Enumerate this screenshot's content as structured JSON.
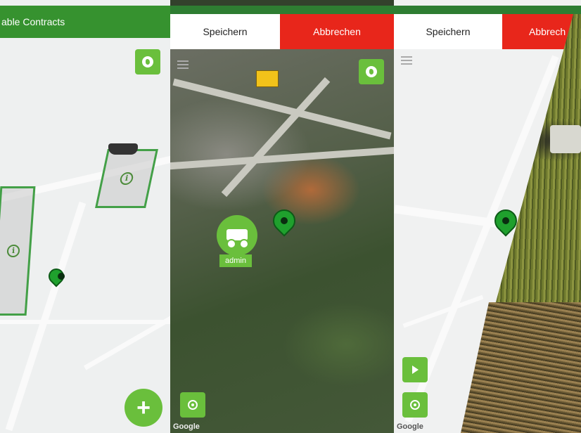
{
  "screen1": {
    "title": "able Contracts",
    "add_button": "+",
    "field_info_glyph": "i"
  },
  "screen2": {
    "save_label": "Speichern",
    "cancel_label": "Abbrechen",
    "user_label": "admin",
    "google": "Google"
  },
  "screen3": {
    "save_label": "Speichern",
    "cancel_label": "Abbrech",
    "google": "Google"
  },
  "icons": [
    "globe-icon",
    "info-icon",
    "map-pin-icon",
    "harvester-icon",
    "locate-icon",
    "menu-icon",
    "play-icon",
    "plus-icon"
  ],
  "colors": {
    "green": "#6abf3c",
    "appbar": "#36922f",
    "cancel": "#e8261b"
  }
}
